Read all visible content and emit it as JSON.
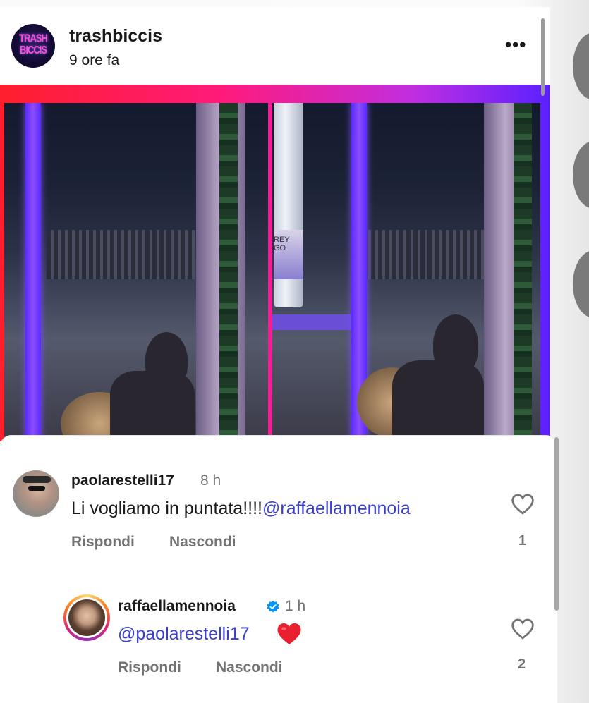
{
  "post": {
    "username": "trashbiccis",
    "time": "9 ore fa",
    "avatar_logo_line1": "TRASH",
    "avatar_logo_line2": "BICCIS",
    "more_icon": "more-horizontal-icon",
    "bottle_label": "REY GO"
  },
  "comments": [
    {
      "username": "paolarestelli17",
      "time": "8 h",
      "text": "Li vogliamo in puntata!!!!",
      "mention": "@raffaellamennoia",
      "reply_label": "Rispondi",
      "hide_label": "Nascondi",
      "like_icon": "heart-outline-icon",
      "like_count": "1"
    },
    {
      "username": "raffaellamennoia",
      "verified": true,
      "time": "1 h",
      "mention": "@paolarestelli17",
      "emoji": "red-heart-icon",
      "reply_label": "Rispondi",
      "hide_label": "Nascondi",
      "like_icon": "heart-outline-icon",
      "like_count": "2"
    }
  ],
  "colors": {
    "mention": "#3a3fd1",
    "secondary_text": "#737373",
    "verified": "#0095f6",
    "red_heart": "#e8202f"
  }
}
